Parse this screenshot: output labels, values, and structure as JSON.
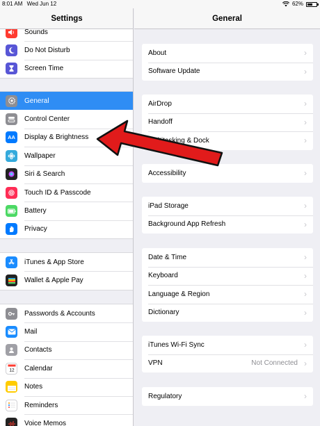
{
  "status": {
    "time": "8:01 AM",
    "date": "Wed Jun 12",
    "battery": "62%",
    "battery_level": 0.62
  },
  "left": {
    "title": "Settings",
    "groups": [
      [
        {
          "label": "Sounds",
          "icon": "speaker-icon",
          "color": "#ff3b30"
        },
        {
          "label": "Do Not Disturb",
          "icon": "moon-icon",
          "color": "#5856d6"
        },
        {
          "label": "Screen Time",
          "icon": "hourglass-icon",
          "color": "#5856d6"
        }
      ],
      [
        {
          "label": "General",
          "icon": "gear-icon",
          "color": "#8e8e93",
          "selected": true
        },
        {
          "label": "Control Center",
          "icon": "toggles-icon",
          "color": "#8e8e93"
        },
        {
          "label": "Display & Brightness",
          "icon": "aa-icon",
          "color": "#007aff"
        },
        {
          "label": "Wallpaper",
          "icon": "flower-icon",
          "color": "#34aadc"
        },
        {
          "label": "Siri & Search",
          "icon": "siri-icon",
          "color": "#222222"
        },
        {
          "label": "Touch ID & Passcode",
          "icon": "fingerprint-icon",
          "color": "#ff2d55"
        },
        {
          "label": "Battery",
          "icon": "battery-icon",
          "color": "#4cd964"
        },
        {
          "label": "Privacy",
          "icon": "hand-icon",
          "color": "#007aff"
        }
      ],
      [
        {
          "label": "iTunes & App Store",
          "icon": "app-store-icon",
          "color": "#1a8cff"
        },
        {
          "label": "Wallet & Apple Pay",
          "icon": "wallet-icon",
          "color": "#222222"
        }
      ],
      [
        {
          "label": "Passwords & Accounts",
          "icon": "key-icon",
          "color": "#8e8e93"
        },
        {
          "label": "Mail",
          "icon": "mail-icon",
          "color": "#1a8cff"
        },
        {
          "label": "Contacts",
          "icon": "contacts-icon",
          "color": "#a0a0a6"
        },
        {
          "label": "Calendar",
          "icon": "calendar-icon",
          "color": "#ffffff"
        },
        {
          "label": "Notes",
          "icon": "notes-icon",
          "color": "#ffcc00"
        },
        {
          "label": "Reminders",
          "icon": "reminders-icon",
          "color": "#ffffff"
        },
        {
          "label": "Voice Memos",
          "icon": "voice-memos-icon",
          "color": "#222222"
        }
      ]
    ]
  },
  "right": {
    "title": "General",
    "groups": [
      [
        {
          "label": "About"
        },
        {
          "label": "Software Update"
        }
      ],
      [
        {
          "label": "AirDrop"
        },
        {
          "label": "Handoff"
        },
        {
          "label": "Multitasking & Dock"
        }
      ],
      [
        {
          "label": "Accessibility"
        }
      ],
      [
        {
          "label": "iPad Storage"
        },
        {
          "label": "Background App Refresh"
        }
      ],
      [
        {
          "label": "Date & Time"
        },
        {
          "label": "Keyboard"
        },
        {
          "label": "Language & Region"
        },
        {
          "label": "Dictionary"
        }
      ],
      [
        {
          "label": "iTunes Wi-Fi Sync"
        },
        {
          "label": "VPN",
          "value": "Not Connected"
        }
      ],
      [
        {
          "label": "Regulatory"
        }
      ]
    ]
  },
  "colors": {
    "selected": "#2f8df4",
    "arrow": "#e11b1b"
  }
}
